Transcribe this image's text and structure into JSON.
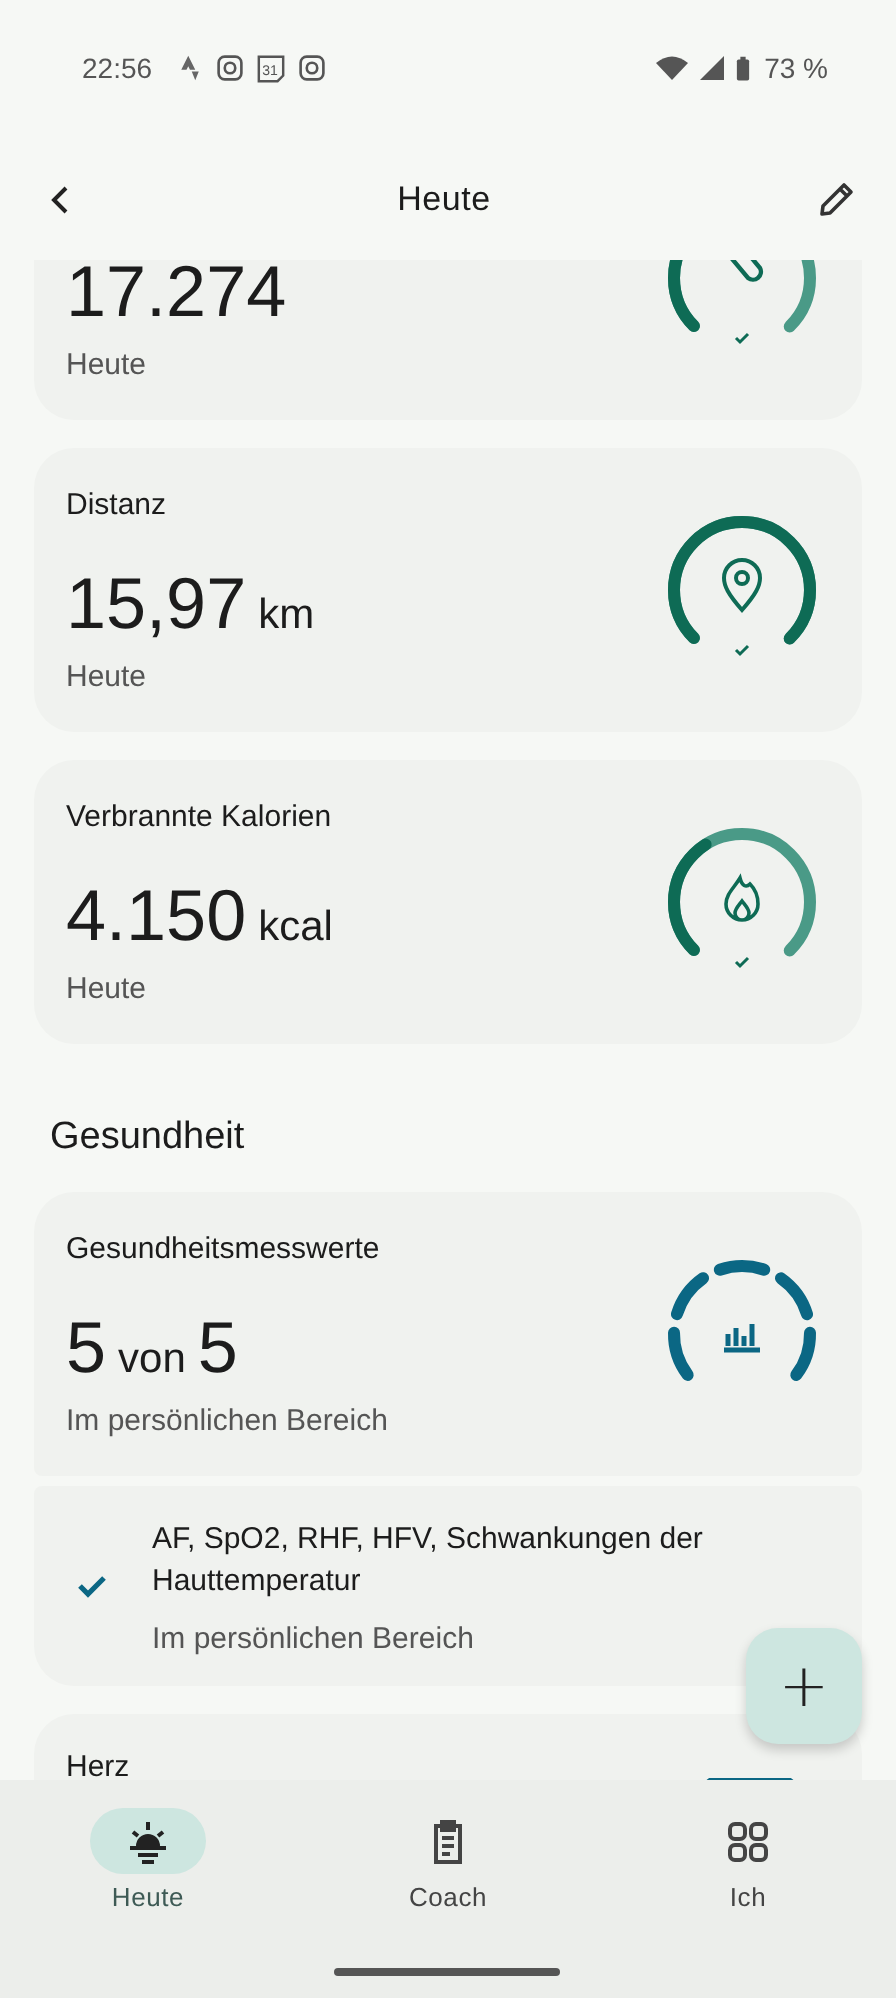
{
  "status_bar": {
    "time": "22:56",
    "calendar_day": "31",
    "battery": "73 %"
  },
  "app_bar": {
    "title": "Heute"
  },
  "cards": [
    {
      "kind": "steps",
      "value": "17.274",
      "period": "Heute"
    },
    {
      "kind": "distance",
      "title": "Distanz",
      "value": "15,97",
      "unit": "km",
      "period": "Heute"
    },
    {
      "kind": "calories",
      "title": "Verbrannte Kalorien",
      "value": "4.150",
      "unit": "kcal",
      "period": "Heute"
    }
  ],
  "section_title": "Gesundheit",
  "health_card": {
    "title": "Gesundheitsmesswerte",
    "value": "5",
    "unit": "von",
    "value_end": "5",
    "period": "Im persönlichen Bereich"
  },
  "health_detail": {
    "checked": true,
    "text": "AF, SpO2, RHF, HFV, Schwankungen der Hauttemperatur",
    "subtitle": "Im persönlichen Bereich"
  },
  "heart_card": {
    "title": "Herz"
  },
  "fab": {
    "label": "+"
  },
  "nav": [
    {
      "label": "Heute",
      "selected": true
    },
    {
      "label": "Coach",
      "selected": false
    },
    {
      "label": "Ich",
      "selected": false
    }
  ]
}
